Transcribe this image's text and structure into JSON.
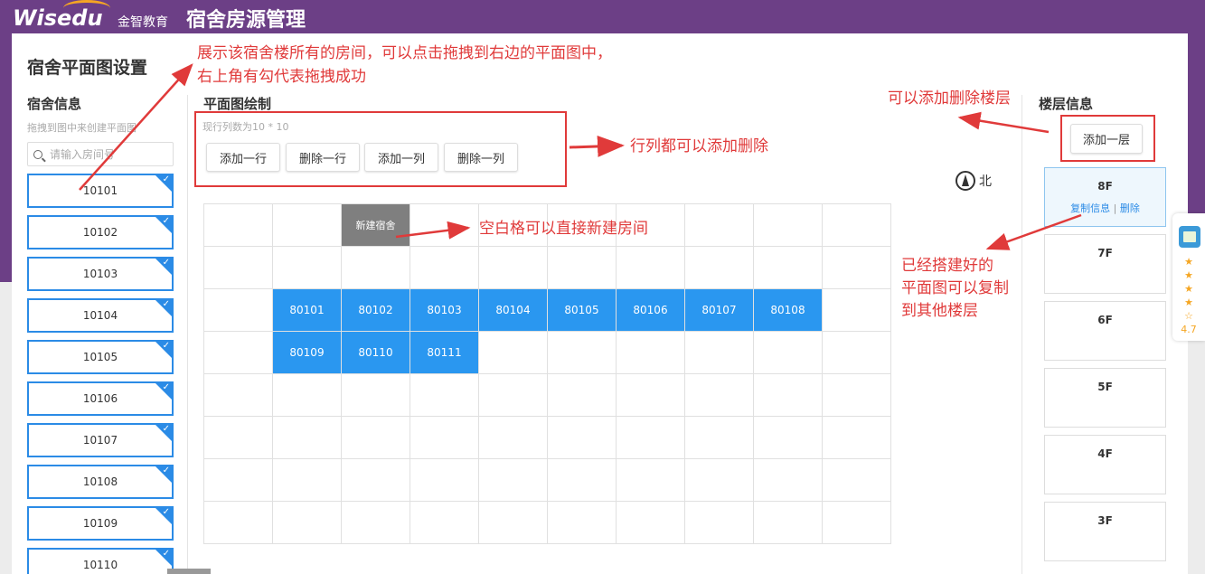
{
  "header": {
    "logo_text": "Wisedu",
    "logo_cn": "金智教育",
    "app_title": "宿舍房源管理"
  },
  "page": {
    "title": "宿舍平面图设置"
  },
  "dorm_info": {
    "title": "宿舍信息",
    "hint": "拖拽到图中来创建平面图",
    "search_placeholder": "请输入房间号",
    "rooms": [
      "10101",
      "10102",
      "10103",
      "10104",
      "10105",
      "10106",
      "10107",
      "10108",
      "10109",
      "10110"
    ]
  },
  "plan": {
    "title": "平面图绘制",
    "size_text": "现行列数为10 * 10",
    "buttons": {
      "add_row": "添加一行",
      "del_row": "删除一行",
      "add_col": "添加一列",
      "del_col": "删除一列"
    },
    "new_cell_label": "新建宿舍",
    "row3_rooms": [
      "80101",
      "80102",
      "80103",
      "80104",
      "80105",
      "80106",
      "80107",
      "80108"
    ],
    "row4_rooms": [
      "80109",
      "80110",
      "80111"
    ]
  },
  "floors": {
    "title": "楼层信息",
    "add_button": "添加一层",
    "compass_label": "北",
    "active": {
      "name": "8F",
      "copy_link": "复制信息",
      "sep": "|",
      "delete_link": "删除"
    },
    "others": [
      "7F",
      "6F",
      "5F",
      "4F",
      "3F"
    ]
  },
  "annotations": {
    "rooms_note_1": "展示该宿舍楼所有的房间，可以点击拖拽到右边的平面图中，",
    "rooms_note_2": "右上角有勾代表拖拽成功",
    "floors_note": "可以添加删除楼层",
    "rowcol_note": "行列都可以添加删除",
    "blank_note": "空白格可以直接新建房间",
    "copy_note_1": "已经搭建好的",
    "copy_note_2": "平面图可以复制",
    "copy_note_3": "到其他楼层"
  },
  "widget": {
    "stars": "★★★★☆",
    "rating": "4.7"
  },
  "colors": {
    "header_bg": "#6c3f86",
    "accent_blue": "#2a97f0",
    "annotation_red": "#e03a3a",
    "new_cell_gray": "#7f7f7f"
  }
}
